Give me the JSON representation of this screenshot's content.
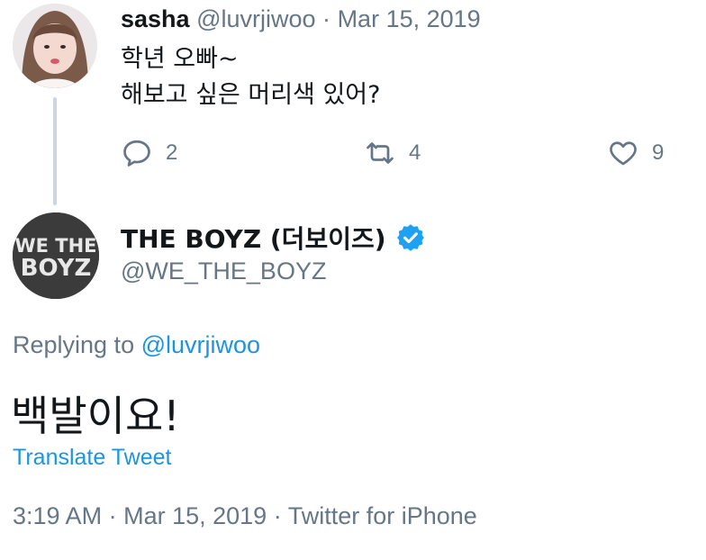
{
  "parent_tweet": {
    "display_name": "sasha",
    "handle": "@luvrjiwoo",
    "separator": "·",
    "date": "Mar 15, 2019",
    "text_line1": "학년 오빠~",
    "text_line2": "해보고 싶은 머리색 있어?",
    "replies": "2",
    "retweets": "4",
    "likes": "9"
  },
  "main_tweet": {
    "display_name": "THE BOYZ (더보이즈)",
    "handle": "@WE_THE_BOYZ",
    "avatar_logo_top": "WE THE",
    "avatar_logo_bottom": "BOYZ",
    "replying_prefix": "Replying to",
    "replying_handle": "@luvrjiwoo",
    "text": "백발이요!",
    "translate_label": "Translate Tweet",
    "time": "3:19 AM",
    "sep1": "·",
    "date": "Mar 15, 2019",
    "sep2": "·",
    "source": "Twitter for iPhone"
  },
  "colors": {
    "link": "#1b95e0",
    "muted": "#657786",
    "text": "#14171a",
    "verified": "#1da1f2"
  },
  "icons": [
    "reply-icon",
    "retweet-icon",
    "like-icon",
    "verified-icon"
  ]
}
